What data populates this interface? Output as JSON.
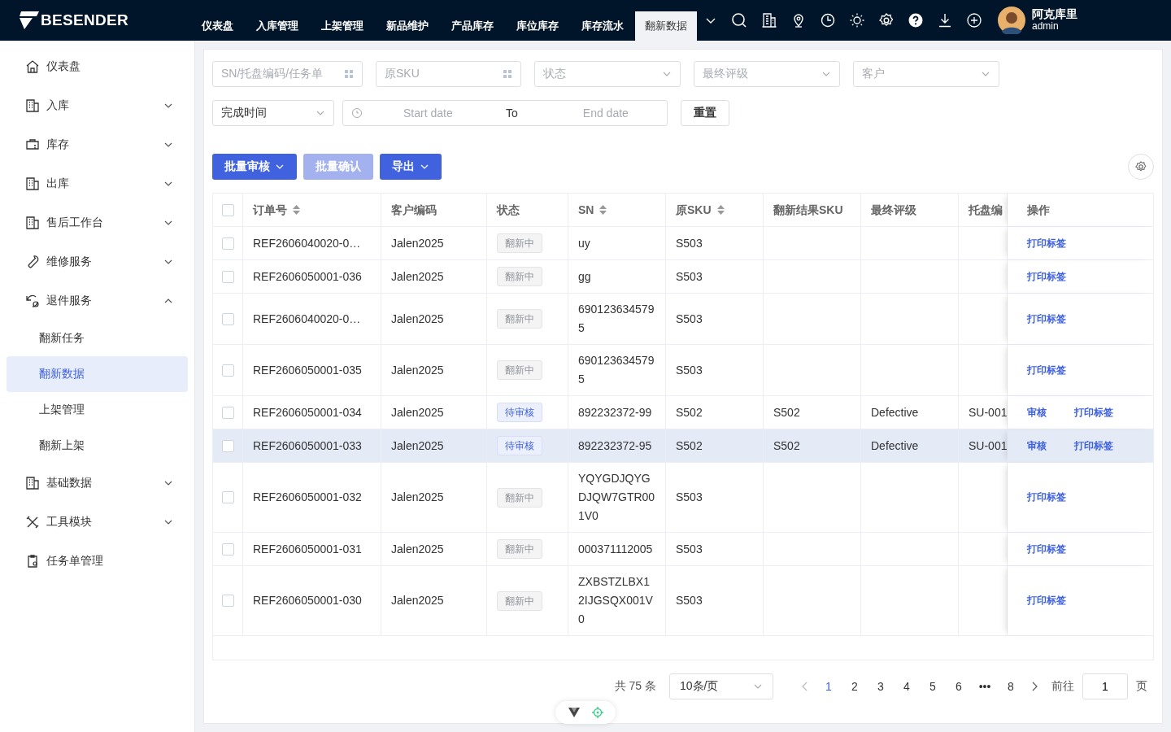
{
  "brand": "BESENDER",
  "nav": [
    {
      "label": "仪表盘",
      "selected": false
    },
    {
      "label": "入库管理",
      "selected": false
    },
    {
      "label": "上架管理",
      "selected": false
    },
    {
      "label": "新品维护",
      "selected": false
    },
    {
      "label": "产品库存",
      "selected": false
    },
    {
      "label": "库位库存",
      "selected": false
    },
    {
      "label": "库存流水",
      "selected": false
    },
    {
      "label": "翻新数据",
      "selected": true
    }
  ],
  "user": {
    "name": "阿克库里",
    "role": "admin"
  },
  "sidebar": {
    "items": [
      {
        "label": "仪表盘",
        "has_children": false
      },
      {
        "label": "入库",
        "expanded": false,
        "has_children": true
      },
      {
        "label": "库存",
        "expanded": false,
        "has_children": true
      },
      {
        "label": "出库",
        "expanded": false,
        "has_children": true
      },
      {
        "label": "售后工作台",
        "expanded": false,
        "has_children": true
      },
      {
        "label": "维修服务",
        "expanded": false,
        "has_children": true
      },
      {
        "label": "退件服务",
        "expanded": true,
        "has_children": true,
        "children": [
          {
            "label": "翻新任务",
            "selected": false
          },
          {
            "label": "翻新数据",
            "selected": true
          },
          {
            "label": "上架管理",
            "selected": false
          },
          {
            "label": "翻新上架",
            "selected": false
          }
        ]
      },
      {
        "label": "基础数据",
        "expanded": false,
        "has_children": true
      },
      {
        "label": "工具模块",
        "expanded": false,
        "has_children": true
      },
      {
        "label": "任务单管理",
        "has_children": false
      }
    ]
  },
  "filters": [
    {
      "kind": "input",
      "placeholder": "SN/托盘编码/任务单"
    },
    {
      "kind": "input",
      "placeholder": "原SKU"
    },
    {
      "kind": "select",
      "placeholder": "状态"
    },
    {
      "kind": "select",
      "placeholder": "最终评级"
    },
    {
      "kind": "select",
      "placeholder": "客户"
    }
  ],
  "time_filter": {
    "value": "完成时间",
    "start_placeholder": "Start date",
    "separator": "To",
    "end_placeholder": "End date"
  },
  "reset_button": "重置",
  "actions": [
    {
      "label": "批量审核",
      "dropdown": true,
      "disabled": false
    },
    {
      "label": "批量确认",
      "dropdown": false,
      "disabled": true
    },
    {
      "label": "导出",
      "dropdown": true,
      "disabled": false
    }
  ],
  "table": {
    "header_checked": false,
    "columns": [
      {
        "label": "订单号",
        "sortable": true
      },
      {
        "label": "客户编码",
        "sortable": false
      },
      {
        "label": "状态",
        "sortable": false
      },
      {
        "label": "SN",
        "sortable": true
      },
      {
        "label": "原SKU",
        "sortable": true
      },
      {
        "label": "翻新结果SKU",
        "sortable": false
      },
      {
        "label": "最终评级",
        "sortable": false
      },
      {
        "label": "托盘编"
      },
      {
        "label": "操作",
        "sortable": false
      }
    ],
    "rows": [
      {
        "checked": false,
        "hovered": false,
        "order": "REF2606040020-0…",
        "customer": "Jalen2025",
        "status": {
          "label": "翻新中",
          "kind": "refurbishing"
        },
        "sn": "uy",
        "sku": "S503",
        "result_sku": "",
        "grade": "",
        "pallet": "",
        "links": [
          "打印标签"
        ]
      },
      {
        "checked": false,
        "hovered": false,
        "order": "REF2606050001-036",
        "customer": "Jalen2025",
        "status": {
          "label": "翻新中",
          "kind": "refurbishing"
        },
        "sn": "gg",
        "sku": "S503",
        "result_sku": "",
        "grade": "",
        "pallet": "",
        "links": [
          "打印标签"
        ]
      },
      {
        "checked": false,
        "hovered": false,
        "order": "REF2606040020-0…",
        "customer": "Jalen2025",
        "status": {
          "label": "翻新中",
          "kind": "refurbishing"
        },
        "sn": "6901236345795",
        "sku": "S503",
        "result_sku": "",
        "grade": "",
        "pallet": "",
        "links": [
          "打印标签"
        ]
      },
      {
        "checked": false,
        "hovered": false,
        "order": "REF2606050001-035",
        "customer": "Jalen2025",
        "status": {
          "label": "翻新中",
          "kind": "refurbishing"
        },
        "sn": "6901236345795",
        "sku": "S503",
        "result_sku": "",
        "grade": "",
        "pallet": "",
        "links": [
          "打印标签"
        ]
      },
      {
        "checked": false,
        "hovered": false,
        "order": "REF2606050001-034",
        "customer": "Jalen2025",
        "status": {
          "label": "待审核",
          "kind": "pending"
        },
        "sn": "892232372-99",
        "sku": "S502",
        "result_sku": "S502",
        "grade": "Defective",
        "pallet": "SU-001",
        "links": [
          "审核",
          "打印标签"
        ]
      },
      {
        "checked": false,
        "hovered": true,
        "order": "REF2606050001-033",
        "customer": "Jalen2025",
        "status": {
          "label": "待审核",
          "kind": "pending"
        },
        "sn": "892232372-95",
        "sku": "S502",
        "result_sku": "S502",
        "grade": "Defective",
        "pallet": "SU-001",
        "links": [
          "审核",
          "打印标签"
        ]
      },
      {
        "checked": false,
        "hovered": false,
        "order": "REF2606050001-032",
        "customer": "Jalen2025",
        "status": {
          "label": "翻新中",
          "kind": "refurbishing"
        },
        "sn": "YQYGDJQYGDJQW7GTR001V0",
        "sku": "S503",
        "result_sku": "",
        "grade": "",
        "pallet": "",
        "links": [
          "打印标签"
        ]
      },
      {
        "checked": false,
        "hovered": false,
        "order": "REF2606050001-031",
        "customer": "Jalen2025",
        "status": {
          "label": "翻新中",
          "kind": "refurbishing"
        },
        "sn": "000371112005",
        "sku": "S503",
        "result_sku": "",
        "grade": "",
        "pallet": "",
        "links": [
          "打印标签"
        ]
      },
      {
        "checked": false,
        "hovered": false,
        "order": "REF2606050001-030",
        "customer": "Jalen2025",
        "status": {
          "label": "翻新中",
          "kind": "refurbishing"
        },
        "sn": "ZXBSTZLBX12IJGSQX001V0",
        "sku": "S503",
        "result_sku": "",
        "grade": "",
        "pallet": "",
        "links": [
          "打印标签"
        ]
      }
    ]
  },
  "pagination": {
    "total": "共 75 条",
    "page_size": "10条/页",
    "pages": [
      {
        "label": "1",
        "selected": true
      },
      {
        "label": "2",
        "selected": false
      },
      {
        "label": "3",
        "selected": false
      },
      {
        "label": "4",
        "selected": false
      },
      {
        "label": "5",
        "selected": false
      },
      {
        "label": "6",
        "selected": false
      },
      {
        "label": "•••",
        "selected": false
      },
      {
        "label": "8",
        "selected": false
      }
    ],
    "goto_label": "前往",
    "goto_value": "1",
    "goto_suffix": "页"
  }
}
